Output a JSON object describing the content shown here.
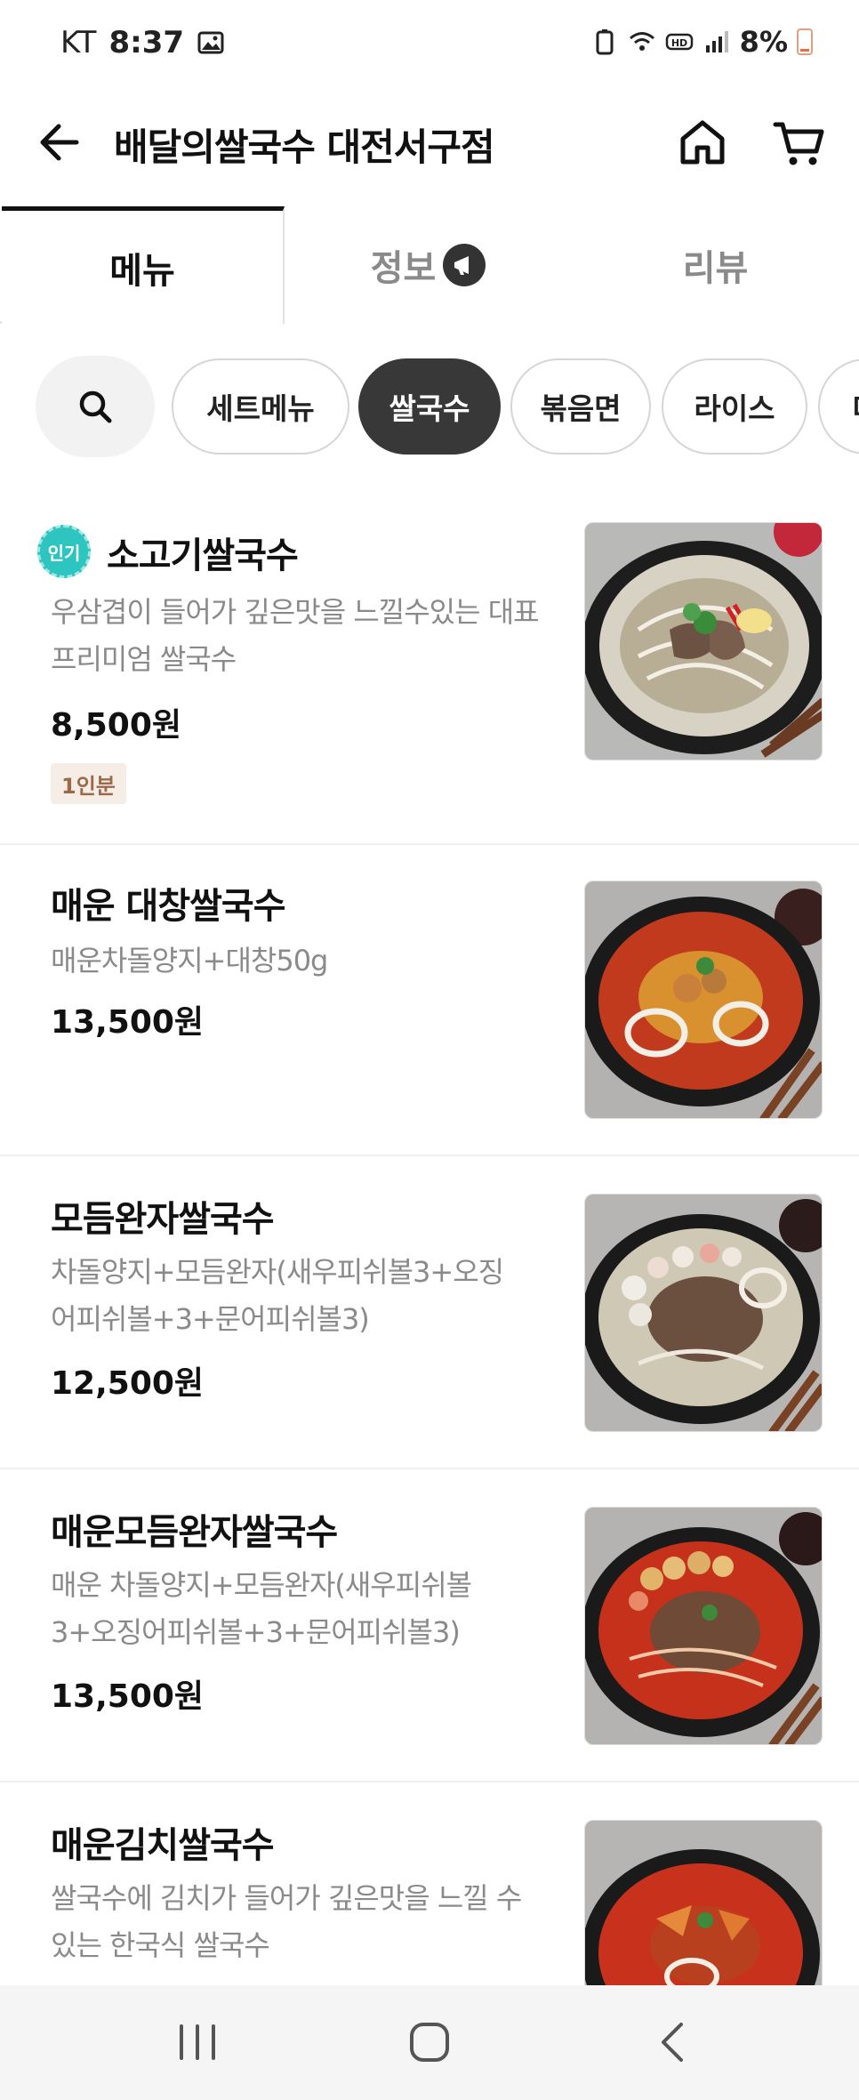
{
  "status_bar": {
    "carrier": "KT",
    "time": "8:37",
    "battery": "8%",
    "icons": [
      "image-icon",
      "battery-saver-icon",
      "wifi-icon",
      "hd-icon",
      "signal-icon",
      "battery-icon"
    ]
  },
  "header": {
    "title": "배달의쌀국수 대전서구점",
    "icons": [
      "back-arrow-icon",
      "home-icon",
      "cart-icon"
    ]
  },
  "tabs": [
    {
      "label": "메뉴",
      "active": true
    },
    {
      "label": "정보",
      "active": false,
      "icon": "megaphone-icon"
    },
    {
      "label": "리뷰",
      "active": false
    }
  ],
  "categories": {
    "search_icon": "search-icon",
    "chips": [
      {
        "label": "세트메뉴",
        "active": false
      },
      {
        "label": "쌀국수",
        "active": true
      },
      {
        "label": "볶음면",
        "active": false
      },
      {
        "label": "라이스",
        "active": false
      },
      {
        "label": "디",
        "active": false
      }
    ]
  },
  "menu": [
    {
      "name": "소고기쌀국수",
      "badge": "인기",
      "description": [
        "우삼겹이 들어가 깊은맛을 느낄수있는 대표",
        "프리미엄 쌀국수"
      ],
      "price": "8,500원",
      "serving": "1인분",
      "broth": "clear"
    },
    {
      "name": "매운 대창쌀국수",
      "description": [
        "매운차돌양지+대창50g"
      ],
      "price": "13,500원",
      "broth": "spicy"
    },
    {
      "name": "모듬완자쌀국수",
      "description": [
        "차돌양지+모듬완자(새우피쉬볼3+오징",
        "어피쉬볼+3+문어피쉬볼3)"
      ],
      "price": "12,500원",
      "broth": "clear"
    },
    {
      "name": "매운모듬완자쌀국수",
      "description": [
        "매운 차돌양지+모듬완자(새우피쉬볼",
        "3+오징어피쉬볼+3+문어피쉬볼3)"
      ],
      "price": "13,500원",
      "broth": "spicy"
    },
    {
      "name": "매운김치쌀국수",
      "description": [
        "쌀국수에 김치가 들어가 깊은맛을 느낄 수",
        "있는 한국식 쌀국수"
      ],
      "price": "",
      "broth": "spicy"
    }
  ],
  "colors": {
    "accent_dark": "#383838",
    "popular_badge": "#2ec4c0",
    "serving_badge_bg": "#f6ede6",
    "serving_badge_text": "#9a6a4a",
    "desc_text": "#8a8a8a"
  },
  "nav_bar": {
    "icons": [
      "recent-apps-icon",
      "home-circle-icon",
      "nav-back-icon"
    ]
  }
}
